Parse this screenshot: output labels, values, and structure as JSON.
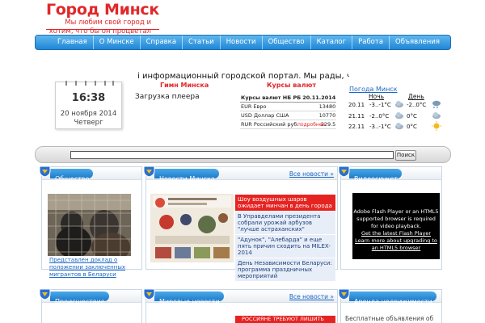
{
  "logo": {
    "title": "Город Минск",
    "slogan": "Мы любим свой город и хотим, что бы он процветал"
  },
  "nav": {
    "items": [
      "Главная",
      "О Минске",
      "Справка",
      "Статьи",
      "Новости",
      "Общество",
      "Каталог",
      "Работа",
      "Объявления"
    ]
  },
  "ticker": "і информационный городской портал. Мы рады, чтс",
  "clock": {
    "time": "16:38",
    "date": "20 ноября 2014",
    "day": "Четверг"
  },
  "anthem": {
    "title": "Гимн Минска",
    "player_text": "Загрузка плеера"
  },
  "rates": {
    "title": "Курсы валют",
    "header": [
      "Курсы валют НБ РБ",
      "20.11.2014"
    ],
    "rows": [
      {
        "name": "EUR Евро",
        "value": "13480"
      },
      {
        "name": "USD Доллар США",
        "value": "10770"
      },
      {
        "name": "RUR Российский руб.",
        "value": "229.5"
      }
    ],
    "more": "подробнее"
  },
  "weather": {
    "title": "Погода Минск",
    "night_label": "Ночь",
    "day_label": "День",
    "rows": [
      {
        "date": "20.11",
        "night": "-3..-1°C",
        "day": "-2..0°C",
        "night_icon": "cloud-icon",
        "day_icon": "snow-cloud-icon"
      },
      {
        "date": "21.11",
        "night": "-2..0°C",
        "day": "0°C",
        "night_icon": "cloud-icon",
        "day_icon": "cloud-icon"
      },
      {
        "date": "22.11",
        "night": "-3..-1°C",
        "day": "0°C",
        "night_icon": "cloud-icon",
        "day_icon": "sun-icon"
      }
    ]
  },
  "search": {
    "placeholder": "",
    "button": "Поиск"
  },
  "panels": {
    "society": {
      "title": "Общество",
      "caption": "Представлен доклад о положении заключенных мигрантов в Беларуси"
    },
    "minsk_news": {
      "title": "Новости Минска",
      "all": "Все новости »",
      "items": [
        "Шоу воздушных шаров ожидает минчан в день города",
        "В Управделами президента собрали урожай арбузов \"лучше астраханских\"",
        "\"Адунок\", \"Алебарда\" и еще пять причин сходить на MILEX-2014",
        "День Независимости Беларуси: программа праздничных мероприятий"
      ]
    },
    "video": {
      "title": "Видеосюжет",
      "lines": [
        "Adobe Flash Player or an HTML5 supported browser is required for video playback."
      ],
      "link1": "Get the latest Flash Player",
      "link2": "Learn more about upgrading to an HTML5 browser"
    },
    "incident": {
      "title": "Происшествие"
    },
    "world_news": {
      "title": "Мировые новости",
      "all": "Все новости »",
      "bottom_item": "РОССИЯНЕ ТРЕБУЮТ ЛИШИТЬ"
    },
    "rent": {
      "title": "Аренда недвижимости",
      "note": "Бесплатные объявления об"
    }
  },
  "colors": {
    "brand_red": "#e0282a",
    "nav_blue": "#1f86d6",
    "link_blue": "#1b66c6",
    "news_red": "#e52421"
  }
}
